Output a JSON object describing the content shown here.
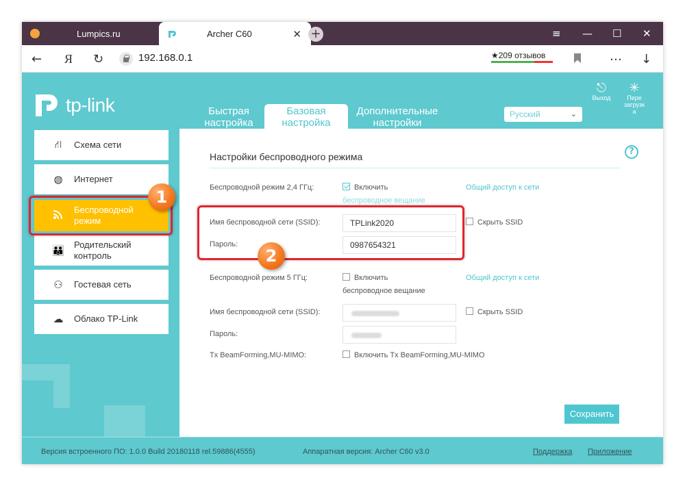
{
  "browser": {
    "tabs": [
      {
        "label": "Lumpics.ru"
      },
      {
        "label": "Archer C60"
      }
    ],
    "new_tab_symbol": "+",
    "window_controls": {
      "menu": "≡",
      "minimize": "—",
      "maximize": "☐",
      "close": "✕"
    },
    "nav": {
      "back": "←",
      "yandex": "Я",
      "reload": "↻"
    },
    "url": "192.168.0.1",
    "reviews": "★209 отзывов",
    "toolbar_icons": {
      "bookmark": "bookmark-icon",
      "more": "…",
      "download": "↓"
    }
  },
  "router": {
    "logo_text": "tp-link",
    "top_tabs": [
      {
        "label_line1": "Быстрая",
        "label_line2": "настройка"
      },
      {
        "label_line1": "Базовая",
        "label_line2": "настройка"
      },
      {
        "label_line1": "Дополнительные",
        "label_line2": "настройки"
      }
    ],
    "language": "Русский",
    "header_buttons": {
      "logout": "Выход",
      "reboot_l1": "Пере",
      "reboot_l2": "загрузк",
      "reboot_l3": "а"
    },
    "sidebar": [
      {
        "label": "Схема сети",
        "icon": "network-map-icon"
      },
      {
        "label": "Интернет",
        "icon": "globe-icon"
      },
      {
        "label_line1": "Беспроводной",
        "label_line2": "режим",
        "icon": "wifi-icon"
      },
      {
        "label_line1": "Родительский",
        "label_line2": "контроль",
        "icon": "parental-icon"
      },
      {
        "label": "Гостевая сеть",
        "icon": "guest-icon"
      },
      {
        "label": "Облако TP-Link",
        "icon": "cloud-icon"
      }
    ],
    "section_title": "Настройки беспроводного режима",
    "band24": {
      "label": "Беспроводной режим 2,4 ГГц:",
      "enable_line1": "Включить",
      "enable_line2": "беспроводное вещание",
      "share_link": "Общий доступ к сети",
      "ssid_label": "Имя беспроводной сети (SSID):",
      "ssid_value": "TPLink2020",
      "hide_ssid": "Скрыть SSID",
      "password_label": "Пароль:",
      "password_value": "0987654321"
    },
    "band5": {
      "label": "Беспроводной режим 5 ГГц:",
      "enable_line1": "Включить",
      "enable_line2": "беспроводное вещание",
      "share_link": "Общий доступ к сети",
      "ssid_label": "Имя беспроводной сети (SSID):",
      "hide_ssid": "Скрыть SSID",
      "password_label": "Пароль:"
    },
    "beamforming": {
      "label": "Tx BeamForming,MU-MIMO:",
      "checkbox": "Включить Tx BeamForming,MU-MIMO"
    },
    "save_button": "Сохранить",
    "footer": {
      "firmware": "Версия встроенного ПО: 1.0.0 Build 20180118 rel.59886(4555)",
      "hardware": "Аппаратная версия: Archer C60 v3.0",
      "support": "Поддержка",
      "app": "Приложение"
    }
  },
  "annotations": {
    "marker1": "1",
    "marker2": "2"
  },
  "colors": {
    "teal": "#5ec9cf",
    "accent": "#4ec6cf",
    "active_item": "#ffc000",
    "annotation_red": "#e0252f",
    "marker_orange": "#f47a21",
    "tabbar": "#4a3446"
  }
}
